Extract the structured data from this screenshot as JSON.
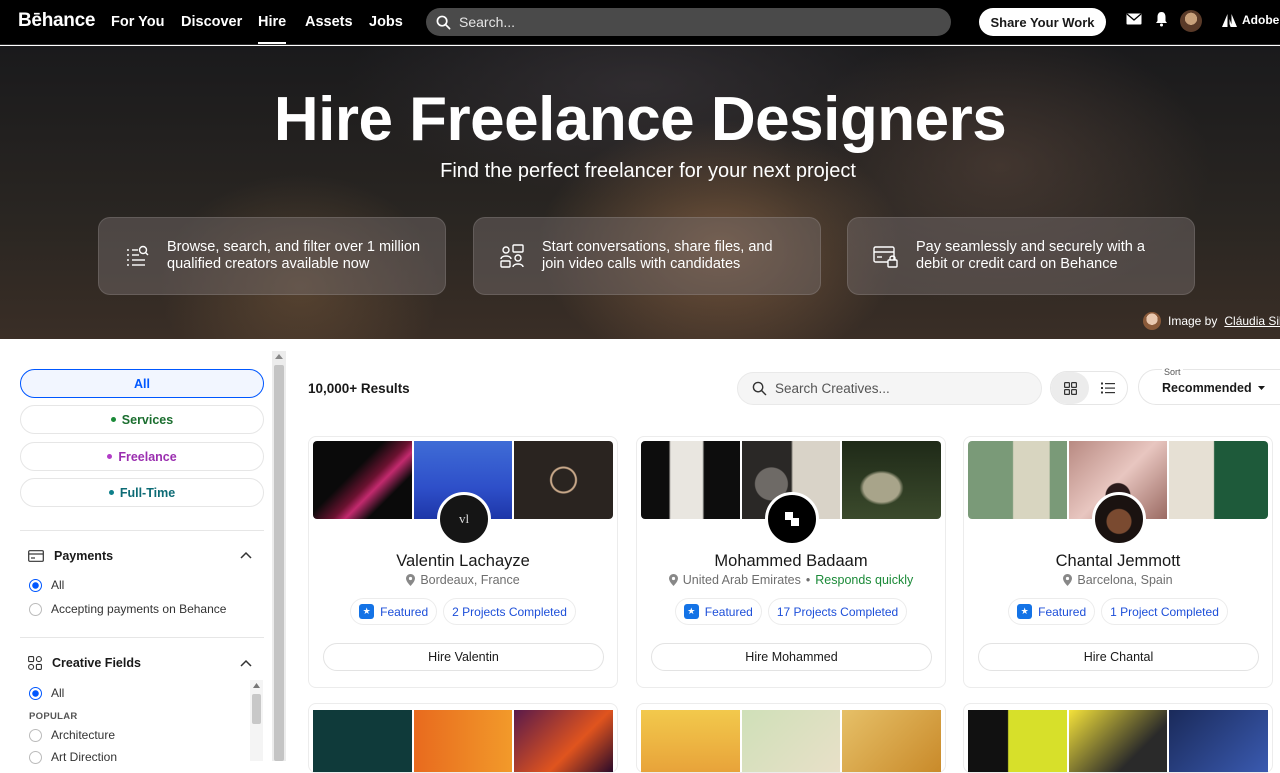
{
  "nav": {
    "logo": "Bēhance",
    "links": [
      "For You",
      "Discover",
      "Hire",
      "Assets",
      "Jobs"
    ],
    "active": "Hire",
    "search_placeholder": "Search...",
    "share_button": "Share Your Work",
    "adobe": "Adobe"
  },
  "hero": {
    "title": "Hire Freelance Designers",
    "subtitle": "Find the perfect freelancer for your next project",
    "features": [
      {
        "line1": "Browse, search, and filter over 1 million",
        "line2": "qualified creators available now",
        "icon": "search-list-icon"
      },
      {
        "line1": "Start conversations, share files, and",
        "line2": "join video calls with candidates",
        "icon": "chat-people-icon"
      },
      {
        "line1": "Pay seamlessly and securely with a",
        "line2": "debit or credit card on Behance",
        "icon": "secure-card-icon"
      }
    ],
    "credit_prefix": "Image by",
    "credit_name": "Cláudia Silva"
  },
  "sidebar": {
    "types": [
      "All",
      "Services",
      "Freelance",
      "Full-Time"
    ],
    "type_dot_colors": [
      "",
      "#1b8a38",
      "#b23cc7",
      "#0d7f8a"
    ],
    "type_text_colors": [
      "#0057ff",
      "#1b6e2f",
      "#9b2fb0",
      "#0d6b75"
    ],
    "payments": {
      "title": "Payments",
      "options": [
        "All",
        "Accepting payments on Behance"
      ],
      "selected": 0
    },
    "creative_fields": {
      "title": "Creative Fields",
      "options_top": "All",
      "popular_label": "POPULAR",
      "options": [
        "Architecture",
        "Art Direction"
      ]
    }
  },
  "main": {
    "results": "10,000+ Results",
    "search_placeholder": "Search Creatives...",
    "sort_label": "Sort",
    "sort_value": "Recommended",
    "cards": [
      {
        "name": "Valentin Lachayze",
        "location": "Bordeaux, France",
        "responds": "",
        "featured": "Featured",
        "projects": "2 Projects Completed",
        "hire": "Hire Valentin",
        "avatar_text": "vl"
      },
      {
        "name": "Mohammed Badaam",
        "location": "United Arab Emirates",
        "responds": "Responds quickly",
        "featured": "Featured",
        "projects": "17 Projects Completed",
        "hire": "Hire Mohammed",
        "avatar_text": ""
      },
      {
        "name": "Chantal Jemmott",
        "location": "Barcelona, Spain",
        "responds": "",
        "featured": "Featured",
        "projects": "1 Project Completed",
        "hire": "Hire Chantal",
        "avatar_text": ""
      }
    ]
  }
}
